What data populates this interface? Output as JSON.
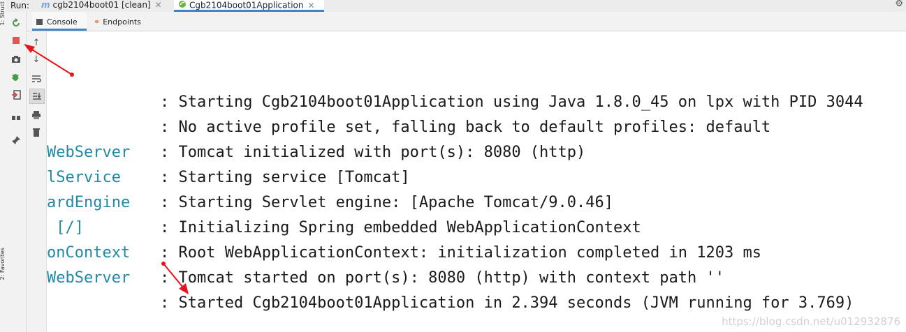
{
  "left_strip": {
    "top_label": "1: Struct",
    "bottom_label": "2: Favorites"
  },
  "tabbar": {
    "run_label": "Run:",
    "tabs": [
      {
        "label": "cgb2104boot01 [clean]",
        "icon": "maven-icon",
        "active": false
      },
      {
        "label": "Cgb2104boot01Application",
        "icon": "spring-boot-icon",
        "active": true
      }
    ]
  },
  "subtabs": [
    {
      "label": "Console",
      "icon": "console-icon",
      "active": true
    },
    {
      "label": "Endpoints",
      "icon": "endpoints-icon",
      "active": false
    }
  ],
  "console": {
    "lines": [
      {
        "logger": "",
        "message": ": Starting Cgb2104boot01Application using Java 1.8.0_45 on lpx with PID 3044"
      },
      {
        "logger": "",
        "message": ": No active profile set, falling back to default profiles: default"
      },
      {
        "logger": "WebServer",
        "message": ": Tomcat initialized with port(s): 8080 (http)"
      },
      {
        "logger": "lService",
        "message": ": Starting service [Tomcat]"
      },
      {
        "logger": "ardEngine",
        "message": ": Starting Servlet engine: [Apache Tomcat/9.0.46]"
      },
      {
        "logger": " [/]",
        "message": ": Initializing Spring embedded WebApplicationContext"
      },
      {
        "logger": "onContext",
        "message": ": Root WebApplicationContext: initialization completed in 1203 ms"
      },
      {
        "logger": "WebServer",
        "message": ": Tomcat started on port(s): 8080 (http) with context path ''"
      },
      {
        "logger": "",
        "message": ": Started Cgb2104boot01Application in 2.394 seconds (JVM running for 3.769)"
      }
    ]
  },
  "watermark": "https://blog.csdn.net/u012932876",
  "colors": {
    "logger": "#1e8aa6",
    "annotation": "#e8141b",
    "active_tab": "#4083c9"
  }
}
